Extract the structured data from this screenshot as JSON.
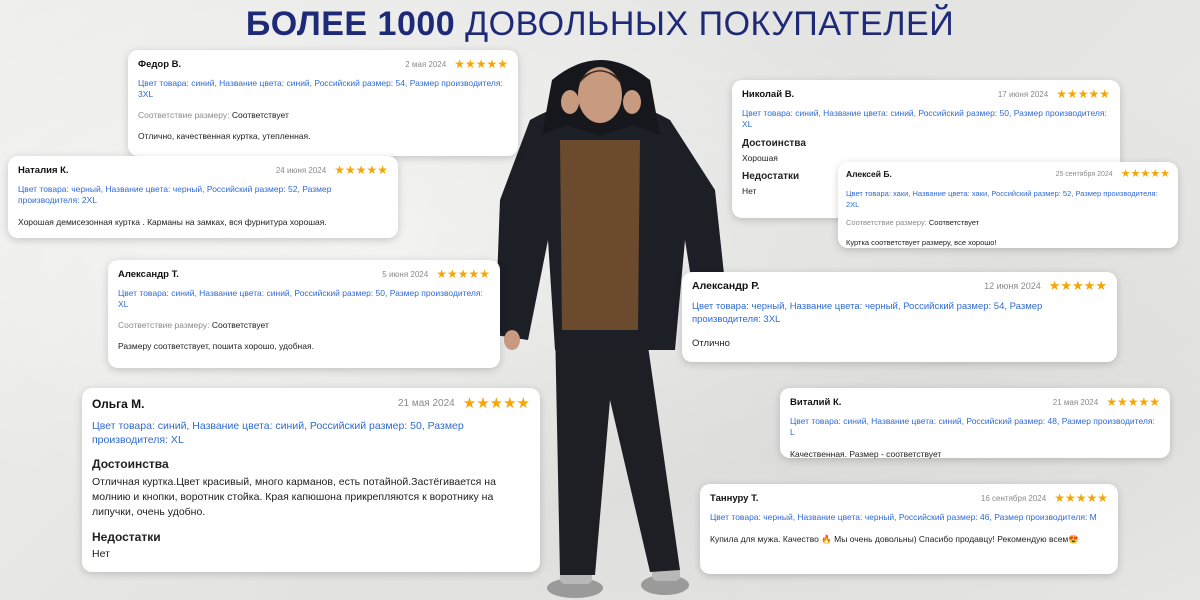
{
  "headline": {
    "bold": "БОЛЕЕ 1000",
    "rest": "ДОВОЛЬНЫХ ПОКУПАТЕЛЕЙ"
  },
  "colors": {
    "headline": "#1e2a78",
    "attrs": "#2f6bd3",
    "star": "#f7a600"
  },
  "rating_stars": "★★★★★",
  "reviews": [
    {
      "name": "Федор В.",
      "date": "2 мая 2024",
      "attrs": "Цвет товара: синий, Название цвета: синий, Российский размер: 54, Размер производителя: 3XL",
      "size_label": "Соответствие размеру:",
      "size_value": "Соответствует",
      "text": "Отлично, качественная куртка, утепленная."
    },
    {
      "name": "Наталия К.",
      "date": "24 июня 2024",
      "attrs": "Цвет товара: черный, Название цвета: черный, Российский размер: 52, Размер производителя: 2XL",
      "text": "Хорошая демисезонная куртка . Карманы на замках, вся фурнитура хорошая."
    },
    {
      "name": "Александр Т.",
      "date": "5 июня 2024",
      "attrs": "Цвет товара: синий, Название цвета: синий, Российский размер: 50, Размер производителя: XL",
      "size_label": "Соответствие размеру:",
      "size_value": "Соответствует",
      "text": "Размеру соответствует, пошита хорошо, удобная."
    },
    {
      "name": "Ольга М.",
      "date": "21 мая 2024",
      "attrs": "Цвет товара: синий, Название цвета: синий, Российский размер: 50, Размер производителя: XL",
      "pros_label": "Достоинства",
      "pros": "Отличная куртка.Цвет красивый, много карманов, есть потайной.Застёгивается на молнию и кнопки, воротник стойка. Края капюшона прикрепляются к воротнику на липучки, очень удобно.",
      "cons_label": "Недостатки",
      "cons": "Нет"
    },
    {
      "name": "Николай В.",
      "date": "17 июня 2024",
      "attrs": "Цвет товара: синий, Название цвета: синий, Российский размер: 50, Размер производителя: XL",
      "pros_label": "Достоинства",
      "pros": "Хорошая",
      "cons_label": "Недостатки",
      "cons": "Нет"
    },
    {
      "name": "Алексей Б.",
      "date": "25 сентября 2024",
      "attrs": "Цвет товара: хаки, Название цвета: хаки, Российский размер: 52, Размер производителя: 2XL",
      "size_label": "Соответствие размеру:",
      "size_value": "Соответствует",
      "text": "Куртка соответствует размеру, все хорошо!"
    },
    {
      "name": "Александр Р.",
      "date": "12 июня 2024",
      "attrs": "Цвет товара: черный, Название цвета: черный, Российский размер: 54, Размер производителя: 3XL",
      "text": "Отлично"
    },
    {
      "name": "Виталий К.",
      "date": "21 мая 2024",
      "attrs": "Цвет товара: синий, Название цвета: синий, Российский размер: 48, Размер производителя: L",
      "text": "Качественная. Размер - соответствует"
    },
    {
      "name": "Таннуру Т.",
      "date": "16 сентября 2024",
      "attrs": "Цвет товара: черный, Название цвета: черный, Российский размер: 46, Размер производителя: M",
      "text": "Купила для мужа. Качество 🔥 Мы очень довольны) Спасибо продавцу! Рекомендую всем😍"
    }
  ]
}
